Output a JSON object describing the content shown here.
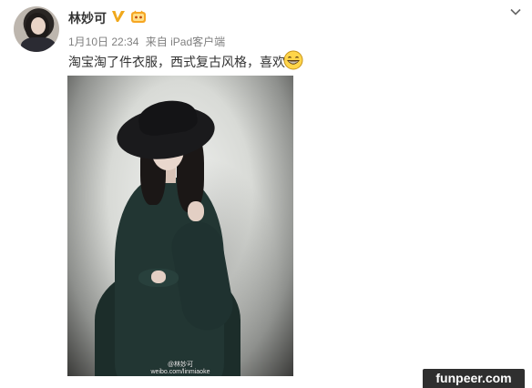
{
  "post": {
    "username": "林妙可",
    "time": "1月10日 22:34",
    "source_prefix": "来自",
    "device": "iPad客户端",
    "content": "淘宝淘了件衣服，西式复古风格，喜欢",
    "photo": {
      "watermark_name": "@林妙可",
      "watermark_url": "weibo.com/linmiaoke"
    }
  },
  "icons": {
    "verified": "verified-v-icon",
    "level": "vip-level-icon",
    "chevron": "chevron-down-icon",
    "emoji": "grin-emoji-icon"
  },
  "colors": {
    "verified_gold": "#f0a81c",
    "meta_gray": "#808080"
  },
  "site_badge": "funpeer.com"
}
